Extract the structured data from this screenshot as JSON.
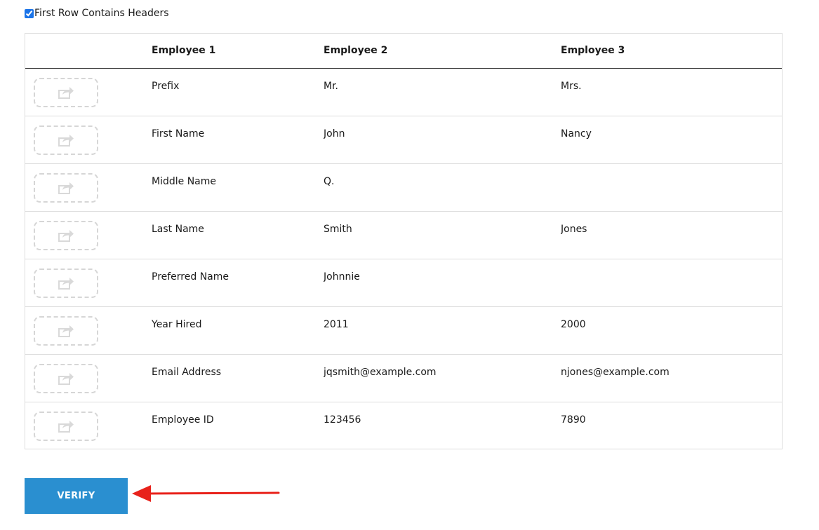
{
  "header_option": {
    "label": "First Row Contains Headers",
    "checked": true
  },
  "table": {
    "columns": [
      "",
      "Employee 1",
      "Employee 2",
      "Employee 3"
    ],
    "rows": [
      {
        "field": "Prefix",
        "emp2": "Mr.",
        "emp3": "Mrs."
      },
      {
        "field": "First Name",
        "emp2": "John",
        "emp3": "Nancy"
      },
      {
        "field": "Middle Name",
        "emp2": "Q.",
        "emp3": ""
      },
      {
        "field": "Last Name",
        "emp2": "Smith",
        "emp3": "Jones"
      },
      {
        "field": "Preferred Name",
        "emp2": "Johnnie",
        "emp3": ""
      },
      {
        "field": "Year Hired",
        "emp2": "2011",
        "emp3": "2000"
      },
      {
        "field": "Email Address",
        "emp2": "jqsmith@example.com",
        "emp3": "njones@example.com"
      },
      {
        "field": "Employee ID",
        "emp2": "123456",
        "emp3": "7890"
      }
    ],
    "drop_target_icon": "share-icon"
  },
  "verify_button": {
    "label": "VERIFY"
  },
  "colors": {
    "button": "#2a8fd0",
    "annotation_arrow": "#e8221b",
    "dashed_border": "#d6d6d6"
  }
}
